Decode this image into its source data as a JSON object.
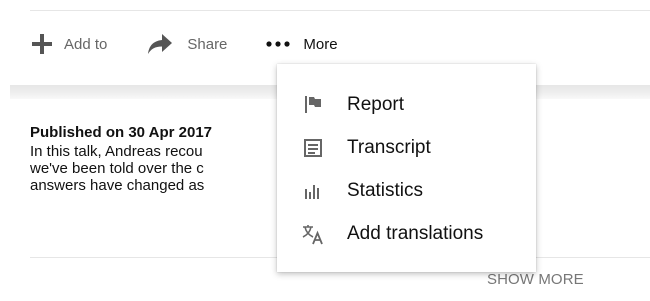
{
  "actions": {
    "add_to_label": "Add to",
    "share_label": "Share",
    "more_label": "More"
  },
  "description": {
    "published": "Published on 30 Apr 2017",
    "line1": "In this talk, Andreas recou                                               nd what it re",
    "line2": "we've been told over the c                                               y\" is, how w",
    "line3": "answers have changed as                                                  d of digital p"
  },
  "show_more_label": "SHOW MORE",
  "menu": {
    "items": [
      {
        "label": "Report",
        "icon": "flag-icon"
      },
      {
        "label": "Transcript",
        "icon": "transcript-icon"
      },
      {
        "label": "Statistics",
        "icon": "statistics-icon"
      },
      {
        "label": "Add translations",
        "icon": "translate-icon"
      }
    ]
  },
  "colors": {
    "icon_gray": "#666666",
    "text_dark": "#111111",
    "divider": "#e6e6e6",
    "show_more": "#777777"
  }
}
